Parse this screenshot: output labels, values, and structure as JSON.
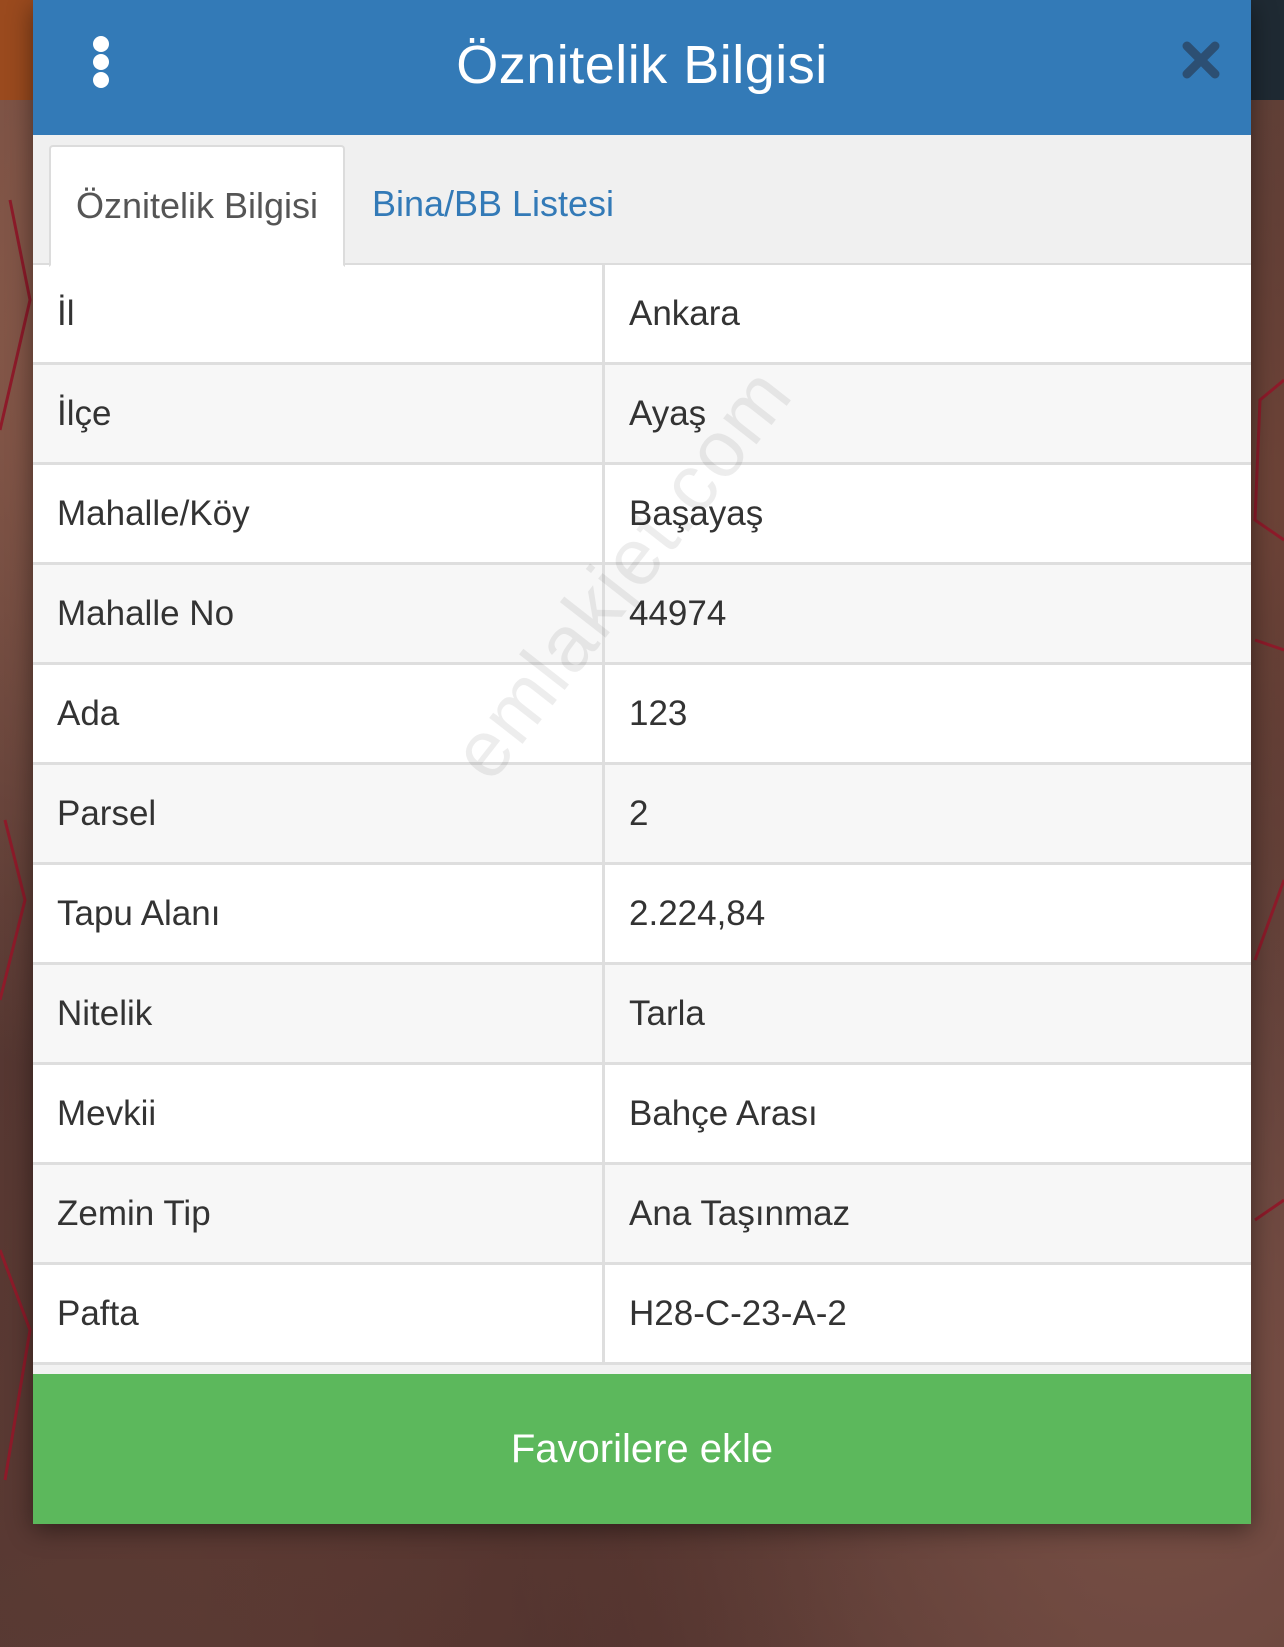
{
  "header": {
    "title": "Öznitelik Bilgisi"
  },
  "tabs": [
    {
      "label": "Öznitelik Bilgisi",
      "active": true
    },
    {
      "label": "Bina/BB Listesi",
      "active": false
    }
  ],
  "attributes": [
    {
      "label": "İl",
      "value": "Ankara"
    },
    {
      "label": "İlçe",
      "value": "Ayaş"
    },
    {
      "label": "Mahalle/Köy",
      "value": "Başayaş"
    },
    {
      "label": "Mahalle No",
      "value": "44974"
    },
    {
      "label": "Ada",
      "value": "123"
    },
    {
      "label": "Parsel",
      "value": "2"
    },
    {
      "label": "Tapu Alanı",
      "value": "2.224,84"
    },
    {
      "label": "Nitelik",
      "value": "Tarla"
    },
    {
      "label": "Mevkii",
      "value": "Bahçe Arası"
    },
    {
      "label": "Zemin Tip",
      "value": "Ana Taşınmaz"
    },
    {
      "label": "Pafta",
      "value": "H28-C-23-A-2"
    }
  ],
  "watermark": "emlakjet.com",
  "footer": {
    "button_label": "Favorilere ekle"
  },
  "colors": {
    "header": "#337ab7",
    "button": "#5cb85c",
    "tab_link": "#337ab7"
  },
  "icons": {
    "menu": "vertical-ellipsis-icon",
    "close": "close-icon"
  }
}
